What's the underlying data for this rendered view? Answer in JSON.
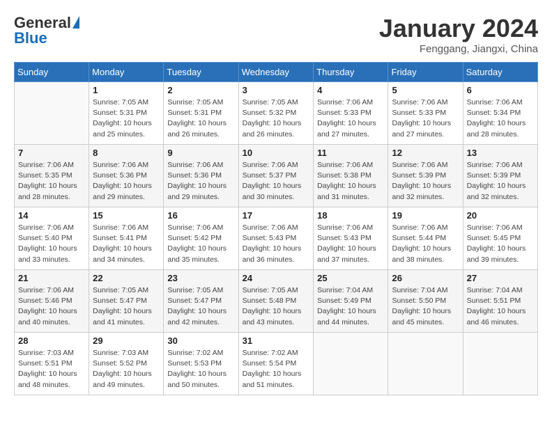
{
  "header": {
    "logo_general": "General",
    "logo_blue": "Blue",
    "month": "January 2024",
    "location": "Fenggang, Jiangxi, China"
  },
  "weekdays": [
    "Sunday",
    "Monday",
    "Tuesday",
    "Wednesday",
    "Thursday",
    "Friday",
    "Saturday"
  ],
  "weeks": [
    [
      {
        "day": "",
        "info": ""
      },
      {
        "day": "1",
        "info": "Sunrise: 7:05 AM\nSunset: 5:31 PM\nDaylight: 10 hours\nand 25 minutes."
      },
      {
        "day": "2",
        "info": "Sunrise: 7:05 AM\nSunset: 5:31 PM\nDaylight: 10 hours\nand 26 minutes."
      },
      {
        "day": "3",
        "info": "Sunrise: 7:05 AM\nSunset: 5:32 PM\nDaylight: 10 hours\nand 26 minutes."
      },
      {
        "day": "4",
        "info": "Sunrise: 7:06 AM\nSunset: 5:33 PM\nDaylight: 10 hours\nand 27 minutes."
      },
      {
        "day": "5",
        "info": "Sunrise: 7:06 AM\nSunset: 5:33 PM\nDaylight: 10 hours\nand 27 minutes."
      },
      {
        "day": "6",
        "info": "Sunrise: 7:06 AM\nSunset: 5:34 PM\nDaylight: 10 hours\nand 28 minutes."
      }
    ],
    [
      {
        "day": "7",
        "info": "Sunrise: 7:06 AM\nSunset: 5:35 PM\nDaylight: 10 hours\nand 28 minutes."
      },
      {
        "day": "8",
        "info": "Sunrise: 7:06 AM\nSunset: 5:36 PM\nDaylight: 10 hours\nand 29 minutes."
      },
      {
        "day": "9",
        "info": "Sunrise: 7:06 AM\nSunset: 5:36 PM\nDaylight: 10 hours\nand 29 minutes."
      },
      {
        "day": "10",
        "info": "Sunrise: 7:06 AM\nSunset: 5:37 PM\nDaylight: 10 hours\nand 30 minutes."
      },
      {
        "day": "11",
        "info": "Sunrise: 7:06 AM\nSunset: 5:38 PM\nDaylight: 10 hours\nand 31 minutes."
      },
      {
        "day": "12",
        "info": "Sunrise: 7:06 AM\nSunset: 5:39 PM\nDaylight: 10 hours\nand 32 minutes."
      },
      {
        "day": "13",
        "info": "Sunrise: 7:06 AM\nSunset: 5:39 PM\nDaylight: 10 hours\nand 32 minutes."
      }
    ],
    [
      {
        "day": "14",
        "info": "Sunrise: 7:06 AM\nSunset: 5:40 PM\nDaylight: 10 hours\nand 33 minutes."
      },
      {
        "day": "15",
        "info": "Sunrise: 7:06 AM\nSunset: 5:41 PM\nDaylight: 10 hours\nand 34 minutes."
      },
      {
        "day": "16",
        "info": "Sunrise: 7:06 AM\nSunset: 5:42 PM\nDaylight: 10 hours\nand 35 minutes."
      },
      {
        "day": "17",
        "info": "Sunrise: 7:06 AM\nSunset: 5:43 PM\nDaylight: 10 hours\nand 36 minutes."
      },
      {
        "day": "18",
        "info": "Sunrise: 7:06 AM\nSunset: 5:43 PM\nDaylight: 10 hours\nand 37 minutes."
      },
      {
        "day": "19",
        "info": "Sunrise: 7:06 AM\nSunset: 5:44 PM\nDaylight: 10 hours\nand 38 minutes."
      },
      {
        "day": "20",
        "info": "Sunrise: 7:06 AM\nSunset: 5:45 PM\nDaylight: 10 hours\nand 39 minutes."
      }
    ],
    [
      {
        "day": "21",
        "info": "Sunrise: 7:06 AM\nSunset: 5:46 PM\nDaylight: 10 hours\nand 40 minutes."
      },
      {
        "day": "22",
        "info": "Sunrise: 7:05 AM\nSunset: 5:47 PM\nDaylight: 10 hours\nand 41 minutes."
      },
      {
        "day": "23",
        "info": "Sunrise: 7:05 AM\nSunset: 5:47 PM\nDaylight: 10 hours\nand 42 minutes."
      },
      {
        "day": "24",
        "info": "Sunrise: 7:05 AM\nSunset: 5:48 PM\nDaylight: 10 hours\nand 43 minutes."
      },
      {
        "day": "25",
        "info": "Sunrise: 7:04 AM\nSunset: 5:49 PM\nDaylight: 10 hours\nand 44 minutes."
      },
      {
        "day": "26",
        "info": "Sunrise: 7:04 AM\nSunset: 5:50 PM\nDaylight: 10 hours\nand 45 minutes."
      },
      {
        "day": "27",
        "info": "Sunrise: 7:04 AM\nSunset: 5:51 PM\nDaylight: 10 hours\nand 46 minutes."
      }
    ],
    [
      {
        "day": "28",
        "info": "Sunrise: 7:03 AM\nSunset: 5:51 PM\nDaylight: 10 hours\nand 48 minutes."
      },
      {
        "day": "29",
        "info": "Sunrise: 7:03 AM\nSunset: 5:52 PM\nDaylight: 10 hours\nand 49 minutes."
      },
      {
        "day": "30",
        "info": "Sunrise: 7:02 AM\nSunset: 5:53 PM\nDaylight: 10 hours\nand 50 minutes."
      },
      {
        "day": "31",
        "info": "Sunrise: 7:02 AM\nSunset: 5:54 PM\nDaylight: 10 hours\nand 51 minutes."
      },
      {
        "day": "",
        "info": ""
      },
      {
        "day": "",
        "info": ""
      },
      {
        "day": "",
        "info": ""
      }
    ]
  ]
}
